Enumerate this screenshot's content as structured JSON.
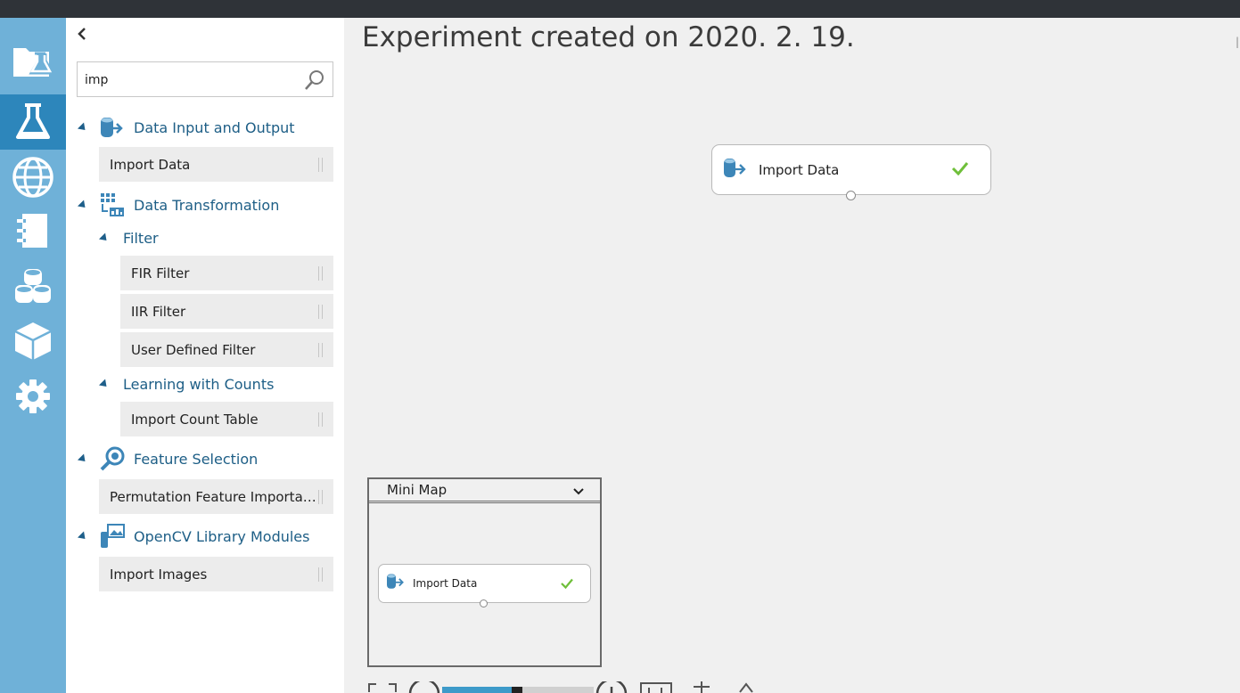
{
  "search": {
    "value": "imp",
    "placeholder": ""
  },
  "palette": {
    "categories": [
      {
        "label": "Data Input and Output",
        "modules": [
          "Import Data"
        ]
      },
      {
        "label": "Data Transformation"
      },
      {
        "label": "Filter",
        "modules": [
          "FIR Filter",
          "IIR Filter",
          "User Defined Filter"
        ]
      },
      {
        "label": "Learning with Counts",
        "modules": [
          "Import Count Table"
        ]
      },
      {
        "label": "Feature Selection",
        "modules": [
          "Permutation Feature Importance"
        ]
      },
      {
        "label": "OpenCV Library Modules",
        "modules": [
          "Import Images"
        ]
      }
    ]
  },
  "canvas": {
    "title": "Experiment created on 2020. 2. 19.",
    "node": {
      "label": "Import Data",
      "status": "done"
    }
  },
  "minimap": {
    "title": "Mini Map",
    "node_label": "Import Data"
  },
  "colors": {
    "nav": "#6fb1d8",
    "nav_active": "#2d86bb",
    "category": "#1d5e86",
    "check": "#6fbf3a"
  },
  "icons": {
    "nav": [
      "projects-icon",
      "experiments-icon",
      "web-services-icon",
      "notebooks-icon",
      "datasets-icon",
      "trained-models-icon",
      "settings-icon"
    ]
  }
}
